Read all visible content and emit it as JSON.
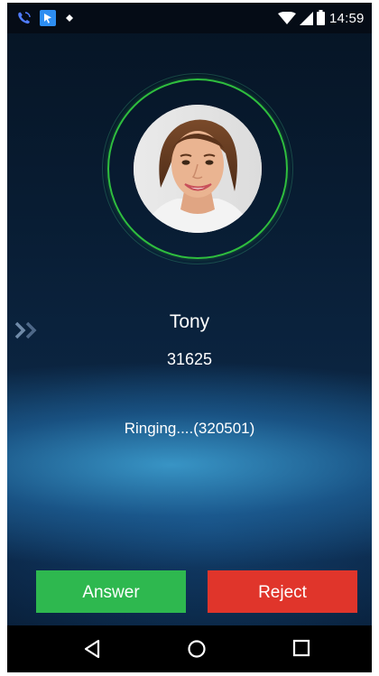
{
  "status_bar": {
    "time": "14:59",
    "icons": [
      "phone-call-icon",
      "app-notification-icon",
      "dot-icon",
      "wifi-icon",
      "cell-signal-icon",
      "battery-icon"
    ]
  },
  "call": {
    "name": "Tony",
    "number": "31625",
    "status": "Ringing....(320501)",
    "avatar_icon": "caller-avatar-photo",
    "ring_color": "#2fbe3e"
  },
  "actions": {
    "answer_label": "Answer",
    "reject_label": "Reject",
    "answer_color": "#2eb84f",
    "reject_color": "#e0352b"
  },
  "navigation": {
    "icons": [
      "back-icon",
      "home-icon",
      "recent-apps-icon"
    ]
  }
}
